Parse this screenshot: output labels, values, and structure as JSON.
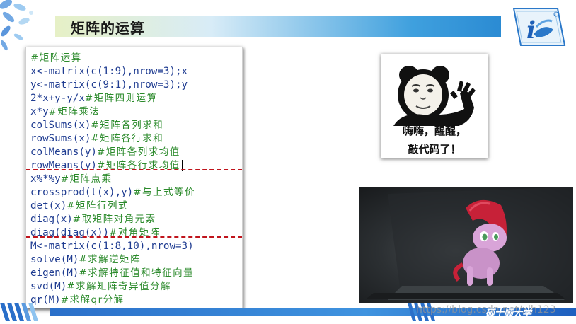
{
  "slide": {
    "title": "矩阵的运算",
    "footer_label": "硕士顺大学",
    "watermark": "https://blog.csdn.net/xlh123"
  },
  "code": {
    "lines": [
      {
        "a": "#矩阵运算",
        "b": "",
        "type": "comment"
      },
      {
        "a": "x<-matrix(c(1:9),nrow=3);x",
        "b": "",
        "type": "code"
      },
      {
        "a": "y<-matrix(c(9:1),nrow=3);y",
        "b": "",
        "type": "code"
      },
      {
        "a": "2*x+y-y/x",
        "b": "#矩阵四则运算",
        "type": "mixed"
      },
      {
        "a": "x*y",
        "b": "#矩阵乘法",
        "type": "mixed"
      },
      {
        "a": "colSums(x)",
        "b": "#矩阵各列求和",
        "type": "mixed"
      },
      {
        "a": "rowSums(x)",
        "b": "#矩阵各行求和",
        "type": "mixed"
      },
      {
        "a": "colMeans(y)",
        "b": "#矩阵各列求均值",
        "type": "mixed"
      },
      {
        "a": "rowMeans(y)",
        "b": "#矩阵各行求均值",
        "type": "mixed"
      },
      {
        "a": "x%*%y",
        "b": "#矩阵点乘",
        "type": "mixed"
      },
      {
        "a": "crossprod(t(x),y)",
        "b": "#与上式等价",
        "type": "mixed"
      },
      {
        "a": "det(x)",
        "b": "#矩阵行列式",
        "type": "mixed"
      },
      {
        "a": "diag(x)",
        "b": "#取矩阵对角元素",
        "type": "mixed"
      },
      {
        "a": "diag(diag(x))",
        "b": "#对角矩阵",
        "type": "mixed"
      },
      {
        "a": "M<-matrix(c(1:8,10),nrow=3)",
        "b": "",
        "type": "code"
      },
      {
        "a": "solve(M)",
        "b": "#求解逆矩阵",
        "type": "mixed"
      },
      {
        "a": "eigen(M)",
        "b": "#求解特征值和特征向量",
        "type": "mixed"
      },
      {
        "a": "svd(M)",
        "b": "#求解矩阵奇异值分解",
        "type": "mixed"
      },
      {
        "a": "qr(M)",
        "b": "#求解qr分解",
        "type": "mixed"
      }
    ]
  },
  "meme": {
    "line1": "嗨嗨，醒醒，",
    "line2": "敲代码了！"
  },
  "colors": {
    "code_text": "#1f3c91",
    "comment_text": "#2b8a2b",
    "separator": "#c0141c",
    "accent_blue": "#2b8bd3"
  },
  "icons": [
    "logo-icon",
    "panda-meme-icon",
    "pony-photo"
  ]
}
